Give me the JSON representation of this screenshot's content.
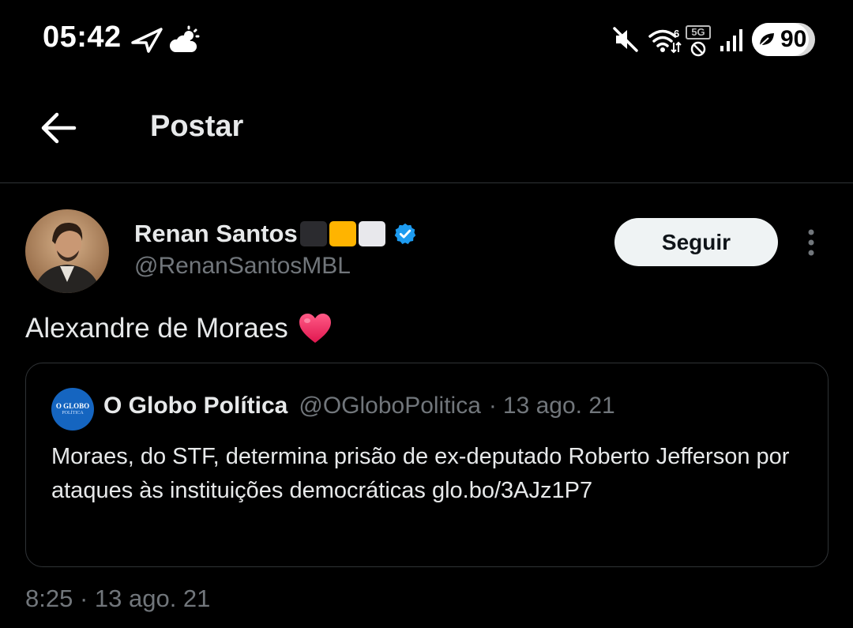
{
  "status_bar": {
    "time": "05:42",
    "network_type": "5G",
    "battery_percent": "90",
    "battery_level": 0.9,
    "icons": [
      "nav-arrow-icon",
      "partly-cloudy-icon",
      "muted-speaker-icon",
      "wifi-icon",
      "5g-blocked-icon",
      "signal-bars-icon",
      "battery-saver-leaf-icon"
    ]
  },
  "header": {
    "title": "Postar",
    "back_icon": "arrow-left-icon"
  },
  "post": {
    "author_name": "Renan Santos",
    "author_handle": "@RenanSantosMBL",
    "name_emoji_colors": [
      "#2b2b2f",
      "#ffb400",
      "#e8e8ec"
    ],
    "verified_color": "#1d9bf0",
    "follow_label": "Seguir",
    "text": "Alexandre de Moraes",
    "heart_color": "#f4245c",
    "timestamp": "8:25 · 13 ago. 21"
  },
  "quote": {
    "avatar_text_top": "O GLOBO",
    "avatar_text_bottom": "POLÍTICA",
    "name": "O Globo Política",
    "handle": "@OGloboPolitica",
    "separator": "·",
    "date": "13 ago. 21",
    "text": "Moraes, do STF, determina prisão de ex-deputado Roberto Jefferson por ataques às instituições democráticas  glo.bo/3AJz1P7"
  },
  "colors": {
    "background": "#000000",
    "text_primary": "#e7e9ea",
    "text_secondary": "#71767b",
    "border": "#2f3336",
    "follow_bg": "#eff3f4"
  }
}
